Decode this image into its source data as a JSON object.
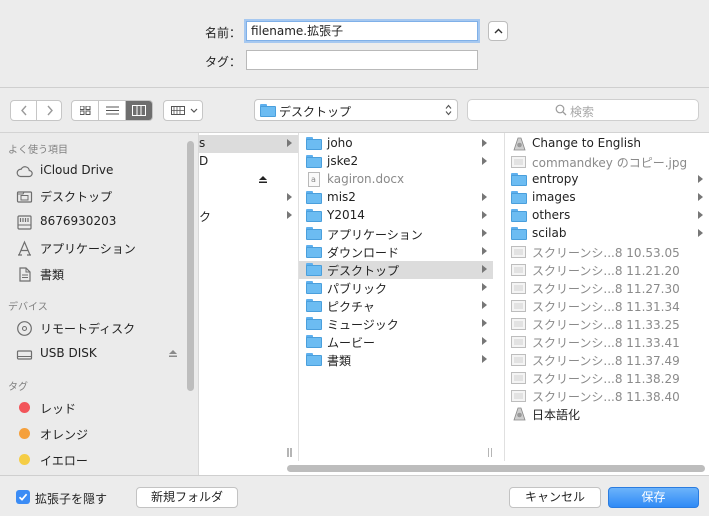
{
  "header": {
    "name_label": "名前：",
    "name_value": "filename.拡張子",
    "tag_label": "タグ：",
    "tag_value": ""
  },
  "toolbar": {
    "location": "デスクトップ",
    "search_placeholder": "検索"
  },
  "sidebar": {
    "favorites_heading": "よく使う項目",
    "favorites": [
      {
        "label": "iCloud Drive",
        "icon": "cloud-icon"
      },
      {
        "label": "デスクトップ",
        "icon": "desktop-folder-icon"
      },
      {
        "label": "8676930203",
        "icon": "drive-icon"
      },
      {
        "label": "アプリケーション",
        "icon": "applications-icon"
      },
      {
        "label": "書類",
        "icon": "documents-icon"
      }
    ],
    "devices_heading": "デバイス",
    "devices": [
      {
        "label": "リモートディスク",
        "icon": "disc-icon"
      },
      {
        "label": "USB DISK",
        "icon": "usb-drive-icon"
      }
    ],
    "tags_heading": "タグ",
    "tags": [
      {
        "label": "レッド",
        "color": "#f2555a"
      },
      {
        "label": "オレンジ",
        "color": "#f5a03c"
      },
      {
        "label": "イエロー",
        "color": "#f5cd45"
      }
    ]
  },
  "columns": {
    "col1_partial": [
      {
        "label": "s",
        "has_arrow": true
      },
      {
        "label": "D",
        "has_arrow": false
      },
      {
        "label": "",
        "has_arrow": false,
        "eject": true
      },
      {
        "label": "",
        "has_arrow": true
      },
      {
        "label": "ク",
        "has_arrow": true
      }
    ],
    "col2": [
      {
        "label": "joho",
        "type": "folder",
        "arrow": true
      },
      {
        "label": "jske2",
        "type": "folder",
        "arrow": true
      },
      {
        "label": "kagiron.docx",
        "type": "doc",
        "arrow": false
      },
      {
        "label": "mis2",
        "type": "folder",
        "arrow": true
      },
      {
        "label": "Y2014",
        "type": "folder",
        "arrow": true
      },
      {
        "label": "アプリケーション",
        "type": "folder",
        "arrow": true
      },
      {
        "label": "ダウンロード",
        "type": "folder",
        "arrow": true
      },
      {
        "label": "デスクトップ",
        "type": "folder",
        "arrow": true
      },
      {
        "label": "パブリック",
        "type": "folder",
        "arrow": true
      },
      {
        "label": "ピクチャ",
        "type": "folder",
        "arrow": true
      },
      {
        "label": "ミュージック",
        "type": "folder",
        "arrow": true
      },
      {
        "label": "ムービー",
        "type": "folder",
        "arrow": true
      },
      {
        "label": "書類",
        "type": "folder",
        "arrow": true
      }
    ],
    "col3": [
      {
        "label": "Change to English",
        "type": "script",
        "arrow": false
      },
      {
        "label": "commandkey のコピー.jpg",
        "type": "image",
        "arrow": false
      },
      {
        "label": "entropy",
        "type": "folder",
        "arrow": true
      },
      {
        "label": "images",
        "type": "folder",
        "arrow": true
      },
      {
        "label": "others",
        "type": "folder",
        "arrow": true
      },
      {
        "label": "scilab",
        "type": "folder",
        "arrow": true
      },
      {
        "label": "スクリーンシ...8 10.53.05",
        "type": "image",
        "arrow": false
      },
      {
        "label": "スクリーンシ...8 11.21.20",
        "type": "image",
        "arrow": false
      },
      {
        "label": "スクリーンシ...8 11.27.30",
        "type": "image",
        "arrow": false
      },
      {
        "label": "スクリーンシ...8 11.31.34",
        "type": "image",
        "arrow": false
      },
      {
        "label": "スクリーンシ...8 11.33.25",
        "type": "image",
        "arrow": false
      },
      {
        "label": "スクリーンシ...8 11.33.41",
        "type": "image",
        "arrow": false
      },
      {
        "label": "スクリーンシ...8 11.37.49",
        "type": "image",
        "arrow": false
      },
      {
        "label": "スクリーンシ...8 11.38.29",
        "type": "image",
        "arrow": false
      },
      {
        "label": "スクリーンシ...8 11.38.40",
        "type": "image",
        "arrow": false
      },
      {
        "label": "日本語化",
        "type": "script",
        "arrow": false
      }
    ]
  },
  "footer": {
    "hide_extension_label": "拡張子を隠す",
    "hide_extension_checked": true,
    "new_folder_label": "新規フォルダ",
    "cancel_label": "キャンセル",
    "save_label": "保存"
  }
}
